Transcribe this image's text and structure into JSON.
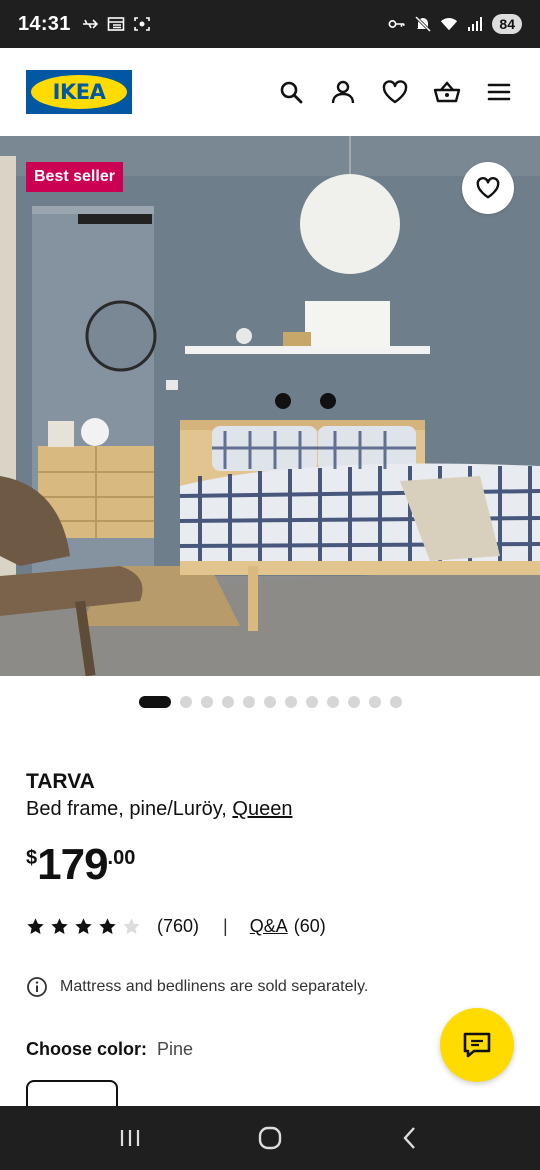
{
  "status_bar": {
    "time": "14:31",
    "battery": "84",
    "left_icons": [
      "usb-icon",
      "screen-icon",
      "screenshot-icon"
    ],
    "right_icons": [
      "key-icon",
      "mute-icon",
      "wifi-icon",
      "signal-icon"
    ]
  },
  "header": {
    "logo_text": "IKEA",
    "icons": [
      "search-icon",
      "account-icon",
      "heart-icon",
      "basket-icon",
      "menu-icon"
    ]
  },
  "hero": {
    "badge": "Best seller",
    "favorite_icon": "heart-icon"
  },
  "carousel": {
    "total": 12,
    "active_index": 0
  },
  "product": {
    "name": "TARVA",
    "description": "Bed frame, pine/Luröy, ",
    "size_link": "Queen",
    "price_currency": "$",
    "price_integer": "179",
    "price_decimal": ".00"
  },
  "rating": {
    "stars": 4,
    "max_stars": 5,
    "review_count": "(760)",
    "separator": "|",
    "qa_label": "Q&A",
    "qa_count": "(60)"
  },
  "note": {
    "text": "Mattress and bedlinens are sold separately."
  },
  "color": {
    "label": "Choose color:",
    "value": "Pine"
  },
  "colors": {
    "brand_blue": "#0058a3",
    "brand_yellow": "#ffdb00",
    "badge_red": "#cc0053"
  }
}
